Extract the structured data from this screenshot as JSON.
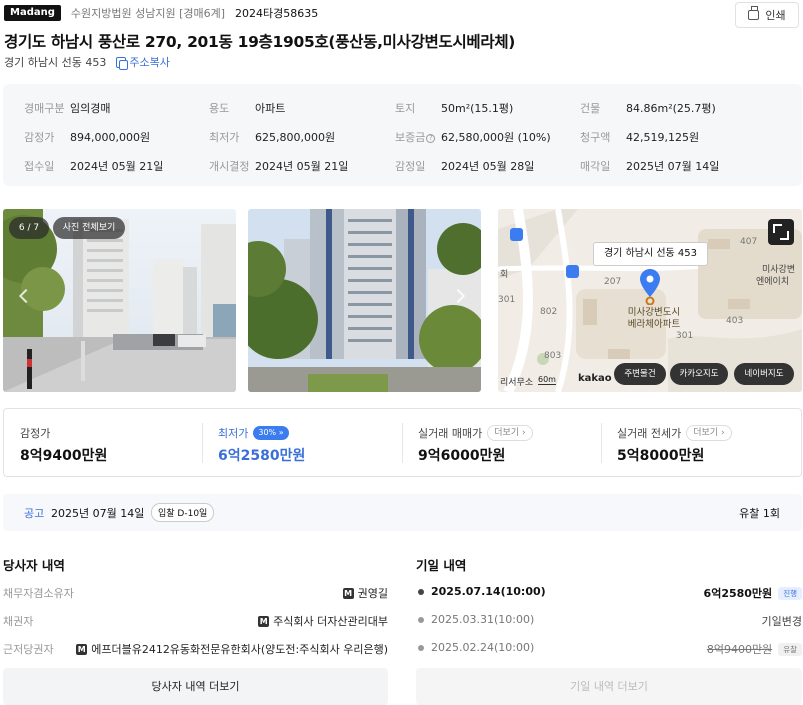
{
  "header": {
    "logo": "Madang",
    "court": "수원지방법원 성남지원 [경매6계]",
    "case_no": "2024타경58635",
    "print_label": "인쇄"
  },
  "property": {
    "title": "경기도 하남시 풍산로 270, 201동 19층1905호(풍산동,미사강변도시베라체)",
    "jibun": "경기 하남시 선동 453",
    "copy_label": "주소복사"
  },
  "info": [
    {
      "label": "경매구분",
      "value": "임의경매"
    },
    {
      "label": "용도",
      "value": "아파트"
    },
    {
      "label": "토지",
      "value": "50m²(15.1평)"
    },
    {
      "label": "건물",
      "value": "84.86m²(25.7평)"
    },
    {
      "label": "감정가",
      "value": "894,000,000원"
    },
    {
      "label": "최저가",
      "value": "625,800,000원"
    },
    {
      "label": "보증금",
      "value": "62,580,000원 (10%)"
    },
    {
      "label": "청구액",
      "value": "42,519,125원"
    },
    {
      "label": "접수일",
      "value": "2024년 05월 21일"
    },
    {
      "label": "개시결정",
      "value": "2024년 05월 21일"
    },
    {
      "label": "감정일",
      "value": "2024년 05월 28일"
    },
    {
      "label": "매각일",
      "value": "2025년 07월 14일"
    }
  ],
  "gallery": {
    "counter": "6 / 7",
    "view_all": "사진 전체보기"
  },
  "map": {
    "callout": "경기 하남시 선동 453",
    "marker_label": "미사강변도시\n베라체아파트",
    "scale": "60m",
    "provider": "kakao",
    "buttons": [
      "주변물건",
      "카카오지도",
      "네이버지도"
    ],
    "labels": [
      "407",
      "207",
      "802",
      "803",
      "회",
      "미사강변",
      "엔에이치",
      "301",
      "403",
      "301",
      "리서무소"
    ]
  },
  "prices": {
    "appraisal": {
      "label": "감정가",
      "value": "8억9400만원"
    },
    "minimum": {
      "label": "최저가",
      "badge": "30%",
      "value": "6억2580만원",
      "color": "#3b6fd8"
    },
    "sale": {
      "label": "실거래 매매가",
      "more": "더보기",
      "value": "9억6000만원"
    },
    "jeonse": {
      "label": "실거래 전세가",
      "more": "더보기",
      "value": "5억8000만원"
    }
  },
  "notice": {
    "label": "공고",
    "date": "2025년 07월 14일",
    "dday": "입찰 D-10일",
    "result": "유찰 1회"
  },
  "parties": {
    "title": "당사자 내역",
    "rows": [
      {
        "label": "채무자겸소유자",
        "value": "권영길"
      },
      {
        "label": "채권자",
        "value": "주식회사 더자산관리대부"
      },
      {
        "label": "근저당권자",
        "value": "에프더블유2412유동화전문유한회사(양도전:주식회사 우리은행)"
      }
    ],
    "more": "당사자 내역 더보기"
  },
  "history": {
    "title": "기일 내역",
    "rows": [
      {
        "date": "2025.07.14(10:00)",
        "value": "6억2580만원",
        "tag": "진행"
      },
      {
        "date": "2025.03.31(10:00)",
        "value": "기일변경",
        "tag": ""
      },
      {
        "date": "2025.02.24(10:00)",
        "value": "8억9400만원",
        "tag": "유찰"
      }
    ],
    "more": "기일 내역 더보기"
  }
}
